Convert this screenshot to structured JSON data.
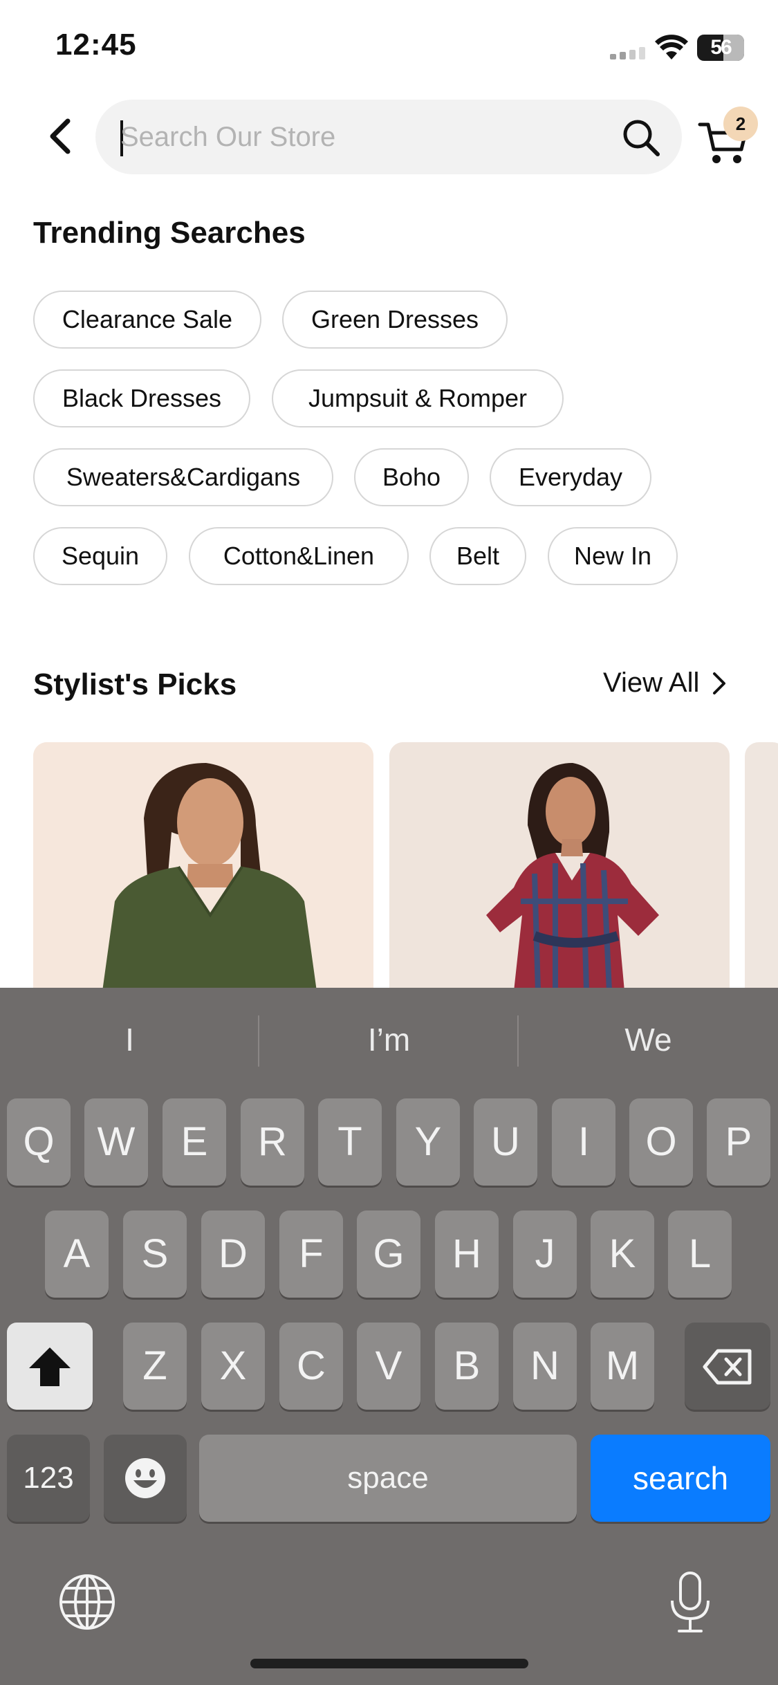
{
  "status_bar": {
    "time": "12:45",
    "battery_level": "56",
    "battery_fraction": 0.56
  },
  "header": {
    "back_icon": "chevron-left-icon",
    "search_placeholder": "Search Our Store",
    "search_icon": "search-icon",
    "cart_icon": "cart-icon",
    "cart_count": "2"
  },
  "trending": {
    "title": "Trending Searches",
    "chips": [
      "Clearance Sale",
      "Green Dresses",
      "Black Dresses",
      "Jumpsuit & Romper",
      "Sweaters&Cardigans",
      "Boho",
      "Everyday",
      "Sequin",
      "Cotton&Linen",
      "Belt",
      "New In"
    ]
  },
  "picks": {
    "title": "Stylist's Picks",
    "view_all": "View All"
  },
  "keyboard": {
    "suggestions": [
      "I",
      "I’m",
      "We"
    ],
    "row1": [
      "Q",
      "W",
      "E",
      "R",
      "T",
      "Y",
      "U",
      "I",
      "O",
      "P"
    ],
    "row2": [
      "A",
      "S",
      "D",
      "F",
      "G",
      "H",
      "J",
      "K",
      "L"
    ],
    "row3": [
      "Z",
      "X",
      "C",
      "V",
      "B",
      "N",
      "M"
    ],
    "numbers_label": "123",
    "space_label": "space",
    "search_label": "search",
    "accent_color": "#0a7cff"
  }
}
